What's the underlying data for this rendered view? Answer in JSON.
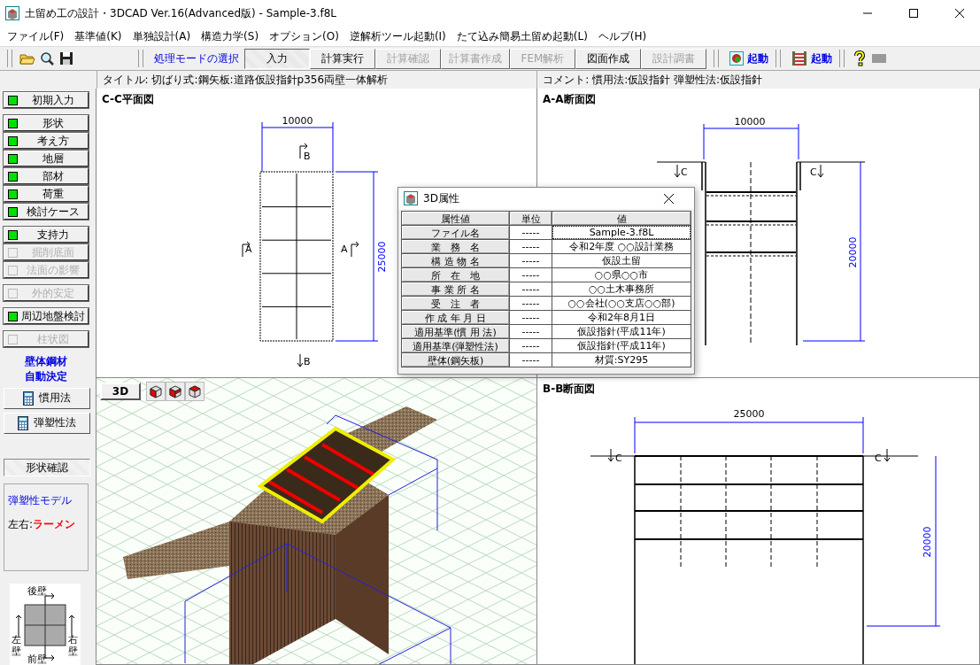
{
  "window": {
    "title": "土留め工の設計・3DCAD Ver.16(Advanced版) - Sample-3.f8L"
  },
  "menu": [
    "ファイル(F)",
    "基準値(K)",
    "単独設計(A)",
    "構造力学(S)",
    "オプション(O)",
    "逆解析ツール起動(I)",
    "たて込み簡易土留め起動(L)",
    "ヘルプ(H)"
  ],
  "toolbar": {
    "mode_label": "処理モードの選択",
    "modes": [
      {
        "label": "入力",
        "selected": true,
        "disabled": false
      },
      {
        "label": "計算実行",
        "selected": false,
        "disabled": false
      },
      {
        "label": "計算確認",
        "selected": false,
        "disabled": true
      },
      {
        "label": "計算書作成",
        "selected": false,
        "disabled": true
      },
      {
        "label": "FEM解析",
        "selected": false,
        "disabled": true
      },
      {
        "label": "図面作成",
        "selected": false,
        "disabled": false
      },
      {
        "label": "設計調書",
        "selected": false,
        "disabled": true
      }
    ],
    "launch": [
      "起動",
      "起動"
    ]
  },
  "info": {
    "title": "タイトル: 切ばり式:鋼矢板:道路仮設指針p356両壁一体解析",
    "comment": "コメント: 慣用法:仮設指針  弾塑性法:仮設指針"
  },
  "sidebar": {
    "groups": [
      [
        {
          "label": "初期入力",
          "disabled": false
        }
      ],
      [
        {
          "label": "形状",
          "disabled": false
        },
        {
          "label": "考え方",
          "disabled": false
        },
        {
          "label": "地層",
          "disabled": false
        },
        {
          "label": "部材",
          "disabled": false
        },
        {
          "label": "荷重",
          "disabled": false
        },
        {
          "label": "検討ケース",
          "disabled": false
        }
      ],
      [
        {
          "label": "支持力",
          "disabled": false
        },
        {
          "label": "掘削底面",
          "disabled": true
        },
        {
          "label": "法面の影響",
          "disabled": true
        }
      ],
      [
        {
          "label": "外的安定",
          "disabled": true
        }
      ],
      [
        {
          "label": "周辺地盤検討",
          "disabled": false
        }
      ],
      [
        {
          "label": "柱状図",
          "disabled": true
        }
      ]
    ],
    "auto_heading": [
      "壁体鋼材",
      "自動決定"
    ],
    "calc_buttons": [
      "慣用法",
      "弾塑性法"
    ],
    "shape_check": "形状確認",
    "model": {
      "title": "弾塑性モデル",
      "label": "左右:",
      "value": "ラーメン"
    },
    "walls": {
      "back": "後壁",
      "left": "左壁",
      "right": "右壁",
      "front": "前壁"
    }
  },
  "views": {
    "plan": {
      "title": "C-C平面図",
      "width_dim": "10000",
      "length_dim": "25000",
      "section_top": "B",
      "section_bottom": "B",
      "section_left": "A",
      "section_right": "A"
    },
    "section_a": {
      "title": "A-A断面図",
      "width_dim": "10000",
      "depth_dim": "20000",
      "marker_left": "C",
      "marker_right": "C"
    },
    "view3d": {
      "button": "3D"
    },
    "section_b": {
      "title": "B-B断面図",
      "width_dim": "25000",
      "depth_dim": "20000",
      "marker_left": "C",
      "marker_right": "C"
    }
  },
  "dialog": {
    "title": "3D属性",
    "columns": [
      "属性値",
      "単位",
      "値"
    ],
    "rows": [
      {
        "name": "ファイル名",
        "unit": "-----",
        "value": "Sample-3.f8L",
        "selected": true
      },
      {
        "name": "業　務　名",
        "unit": "-----",
        "value": "令和2年度 ○○設計業務",
        "selected": false
      },
      {
        "name": "構 造 物 名",
        "unit": "-----",
        "value": "仮設土留",
        "selected": false
      },
      {
        "name": "所　在　地",
        "unit": "-----",
        "value": "○○県○○市",
        "selected": false
      },
      {
        "name": "事 業 所 名",
        "unit": "-----",
        "value": "○○土木事務所",
        "selected": false
      },
      {
        "name": "受　注　者",
        "unit": "-----",
        "value": "○○会社(○○支店○○部)",
        "selected": false
      },
      {
        "name": "作 成 年 月 日",
        "unit": "-----",
        "value": "令和2年8月1日",
        "selected": false
      },
      {
        "name": "適用基準(慣 用 法)",
        "unit": "-----",
        "value": "仮設指針(平成11年)",
        "selected": false
      },
      {
        "name": "適用基準(弾塑性法)",
        "unit": "-----",
        "value": "仮設指針(平成11年)",
        "selected": false
      },
      {
        "name": "壁体(鋼矢板)",
        "unit": "-----",
        "value": "材質:SY295",
        "selected": false
      }
    ]
  }
}
